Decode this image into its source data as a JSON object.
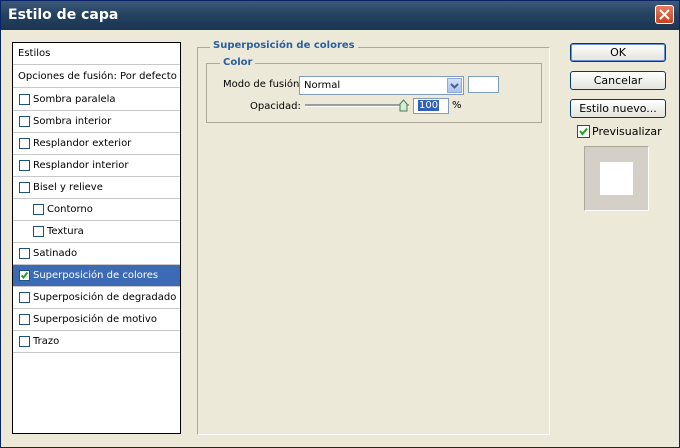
{
  "window": {
    "title": "Estilo de capa"
  },
  "styles": {
    "header": "Estilos",
    "blending": "Opciones de fusión: Por defecto",
    "items": [
      {
        "label": "Sombra paralela",
        "checked": false,
        "indent": false,
        "selected": false
      },
      {
        "label": "Sombra interior",
        "checked": false,
        "indent": false,
        "selected": false
      },
      {
        "label": "Resplandor exterior",
        "checked": false,
        "indent": false,
        "selected": false
      },
      {
        "label": "Resplandor interior",
        "checked": false,
        "indent": false,
        "selected": false
      },
      {
        "label": "Bisel y relieve",
        "checked": false,
        "indent": false,
        "selected": false
      },
      {
        "label": "Contorno",
        "checked": false,
        "indent": true,
        "selected": false
      },
      {
        "label": "Textura",
        "checked": false,
        "indent": true,
        "selected": false
      },
      {
        "label": "Satinado",
        "checked": false,
        "indent": false,
        "selected": false
      },
      {
        "label": "Superposición de colores",
        "checked": true,
        "indent": false,
        "selected": true
      },
      {
        "label": "Superposición de degradado",
        "checked": false,
        "indent": false,
        "selected": false
      },
      {
        "label": "Superposición de motivo",
        "checked": false,
        "indent": false,
        "selected": false
      },
      {
        "label": "Trazo",
        "checked": false,
        "indent": false,
        "selected": false
      }
    ]
  },
  "overlay": {
    "title": "Superposición de colores",
    "color_group": "Color",
    "blend_mode_label": "Modo de fusión:",
    "blend_mode_value": "Normal",
    "opacity_label": "Opacidad:",
    "opacity_value": "100",
    "opacity_unit": "%",
    "swatch_color": "#ffffff"
  },
  "buttons": {
    "ok": "OK",
    "cancel": "Cancelar",
    "new_style": "Estilo nuevo...",
    "preview_label": "Previsualizar",
    "preview_checked": true
  },
  "colors": {
    "accent": "#3d6ab5",
    "title_bar": "#23415f",
    "group_title": "#2a5fa0"
  },
  "icons": {
    "close": "close-icon",
    "check": "checkmark-icon",
    "dropdown": "chevron-down-icon",
    "slider": "slider-thumb-icon"
  }
}
